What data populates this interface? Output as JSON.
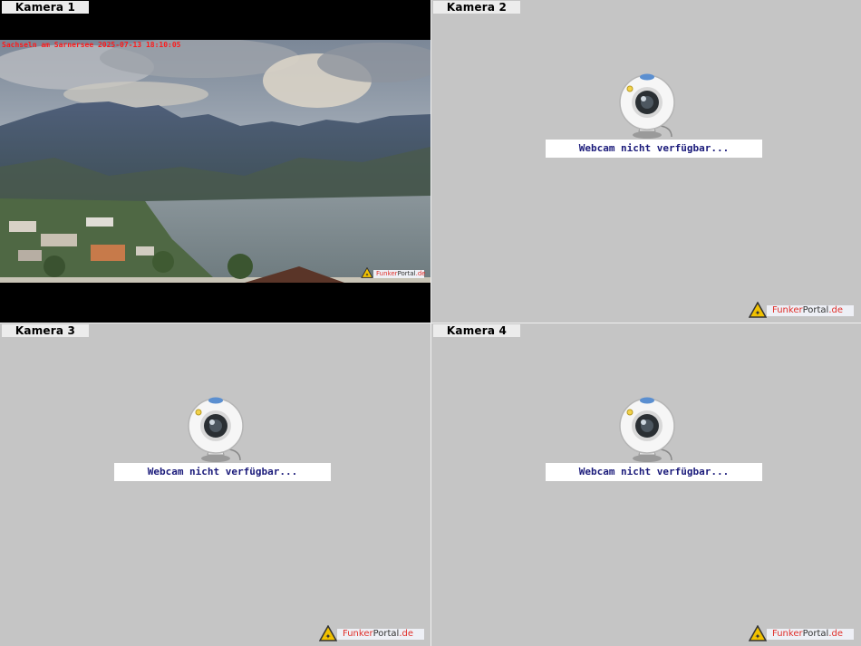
{
  "cameras": [
    {
      "label": "Kamera 1",
      "status": "live",
      "overlay": "Sachseln am Sarnersee 2025-07-13 18:10:05",
      "logo": {
        "part1": "Funker",
        "part2": "Portal",
        "part3": ".de"
      }
    },
    {
      "label": "Kamera 2",
      "status": "unavailable",
      "message": "Webcam nicht verfügbar...",
      "logo": {
        "part1": "Funker",
        "part2": "Portal",
        "part3": ".de"
      }
    },
    {
      "label": "Kamera 3",
      "status": "unavailable",
      "message": "Webcam nicht verfügbar...",
      "logo": {
        "part1": "Funker",
        "part2": "Portal",
        "part3": ".de"
      }
    },
    {
      "label": "Kamera 4",
      "status": "unavailable",
      "message": "Webcam nicht verfügbar...",
      "logo": {
        "part1": "Funker",
        "part2": "Portal",
        "part3": ".de"
      }
    }
  ],
  "colors": {
    "background": "#c5c5c5",
    "label_bg": "#ececec",
    "message_text": "#1a1a7a",
    "overlay_text": "#ff1a1a",
    "logo_red": "#e0302a"
  },
  "icons": {
    "placeholder": "webcam-icon",
    "logo": "warning-triangle-icon"
  }
}
